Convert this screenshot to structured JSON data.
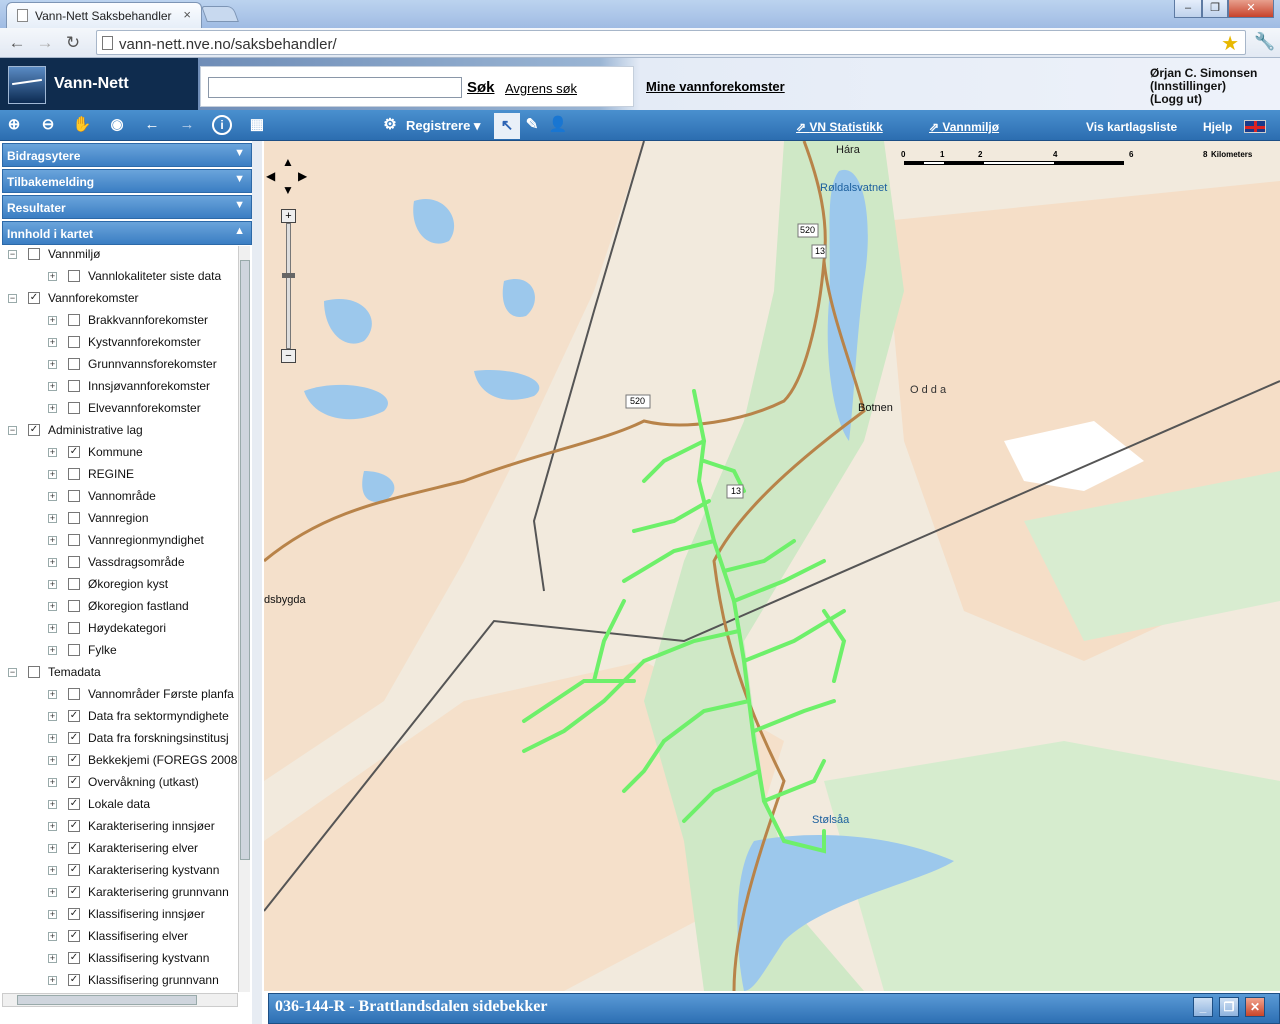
{
  "browser": {
    "tab_title": "Vann-Nett Saksbehandler",
    "tab_close": "×",
    "url": "vann-nett.nve.no/saksbehandler/",
    "window_controls": [
      "–",
      "❐",
      "✕"
    ]
  },
  "header": {
    "app_name": "Vann-Nett",
    "search_placeholder": "",
    "search_label": "Søk",
    "refine_label": "Avgrens søk",
    "my_waterbodies": "Mine vannforekomster",
    "user_name": "Ørjan C. Simonsen",
    "settings": "(Innstillinger)",
    "logout": "(Logg ut)"
  },
  "appbar": {
    "register_label": "Registrere",
    "vn_stats": "VN Statistikk",
    "vannmiljo": "Vannmiljø",
    "layer_list": "Vis kartlagsliste",
    "help": "Hjelp"
  },
  "sidebar": {
    "panels": [
      "Bidragsytere",
      "Tilbakemelding",
      "Resultater",
      "Innhold i kartet"
    ],
    "tree": [
      {
        "level": 0,
        "expand": "−",
        "checked": false,
        "label": "Vannmiljø"
      },
      {
        "level": 1,
        "expand": "+",
        "checked": false,
        "label": "Vannlokaliteter siste data"
      },
      {
        "level": 0,
        "expand": "−",
        "checked": true,
        "label": "Vannforekomster"
      },
      {
        "level": 1,
        "expand": "+",
        "checked": false,
        "label": "Brakkvannforekomster"
      },
      {
        "level": 1,
        "expand": "+",
        "checked": false,
        "label": "Kystvannforekomster"
      },
      {
        "level": 1,
        "expand": "+",
        "checked": false,
        "label": "Grunnvannsforekomster"
      },
      {
        "level": 1,
        "expand": "+",
        "checked": false,
        "label": "Innsjøvannforekomster"
      },
      {
        "level": 1,
        "expand": "+",
        "checked": false,
        "label": "Elvevannforekomster"
      },
      {
        "level": 0,
        "expand": "−",
        "checked": true,
        "label": "Administrative lag"
      },
      {
        "level": 1,
        "expand": "+",
        "checked": true,
        "label": "Kommune"
      },
      {
        "level": 1,
        "expand": "+",
        "checked": false,
        "label": "REGINE"
      },
      {
        "level": 1,
        "expand": "+",
        "checked": false,
        "label": "Vannområde"
      },
      {
        "level": 1,
        "expand": "+",
        "checked": false,
        "label": "Vannregion"
      },
      {
        "level": 1,
        "expand": "+",
        "checked": false,
        "label": "Vannregionmyndighet"
      },
      {
        "level": 1,
        "expand": "+",
        "checked": false,
        "label": "Vassdragsområde"
      },
      {
        "level": 1,
        "expand": "+",
        "checked": false,
        "label": "Økoregion kyst"
      },
      {
        "level": 1,
        "expand": "+",
        "checked": false,
        "label": "Økoregion fastland"
      },
      {
        "level": 1,
        "expand": "+",
        "checked": false,
        "label": "Høydekategori"
      },
      {
        "level": 1,
        "expand": "+",
        "checked": false,
        "label": "Fylke"
      },
      {
        "level": 0,
        "expand": "−",
        "checked": false,
        "label": "Temadata"
      },
      {
        "level": 1,
        "expand": "+",
        "checked": false,
        "label": "Vannområder Første planfa"
      },
      {
        "level": 1,
        "expand": "+",
        "checked": true,
        "label": "Data fra sektormyndighete"
      },
      {
        "level": 1,
        "expand": "+",
        "checked": true,
        "label": "Data fra forskningsinstitusj"
      },
      {
        "level": 1,
        "expand": "+",
        "checked": true,
        "label": "Bekkekjemi (FOREGS 2008"
      },
      {
        "level": 1,
        "expand": "+",
        "checked": true,
        "label": "Overvåkning (utkast)"
      },
      {
        "level": 1,
        "expand": "+",
        "checked": true,
        "label": "Lokale data"
      },
      {
        "level": 1,
        "expand": "+",
        "checked": true,
        "label": "Karakterisering innsjøer"
      },
      {
        "level": 1,
        "expand": "+",
        "checked": true,
        "label": "Karakterisering elver"
      },
      {
        "level": 1,
        "expand": "+",
        "checked": true,
        "label": "Karakterisering kystvann"
      },
      {
        "level": 1,
        "expand": "+",
        "checked": true,
        "label": "Karakterisering grunnvann"
      },
      {
        "level": 1,
        "expand": "+",
        "checked": true,
        "label": "Klassifisering innsjøer"
      },
      {
        "level": 1,
        "expand": "+",
        "checked": true,
        "label": "Klassifisering elver"
      },
      {
        "level": 1,
        "expand": "+",
        "checked": true,
        "label": "Klassifisering kystvann"
      },
      {
        "level": 1,
        "expand": "+",
        "checked": true,
        "label": "Klassifisering grunnvann"
      }
    ]
  },
  "map": {
    "places": {
      "hara": "Hára",
      "roldalsvatnet": "Røldalsvatnet",
      "odda": "O d d a",
      "botnen": "Botnen",
      "bygda": "dsbygda",
      "stolsaa": "Stølsåa"
    },
    "road_shields": {
      "r520a": "520",
      "r13a": "13",
      "r520b": "520",
      "r13b": "13"
    },
    "scale": {
      "ticks": [
        "0",
        "1",
        "2",
        "4",
        "6",
        "8"
      ],
      "unit": "Kilometers"
    },
    "highlight_color": "#6ef06a",
    "water_color": "#9cc8ec",
    "forest_color": "#cfe8c6"
  },
  "bottom_panel": {
    "title": "036-144-R - Brattlandsdalen sidebekker"
  }
}
